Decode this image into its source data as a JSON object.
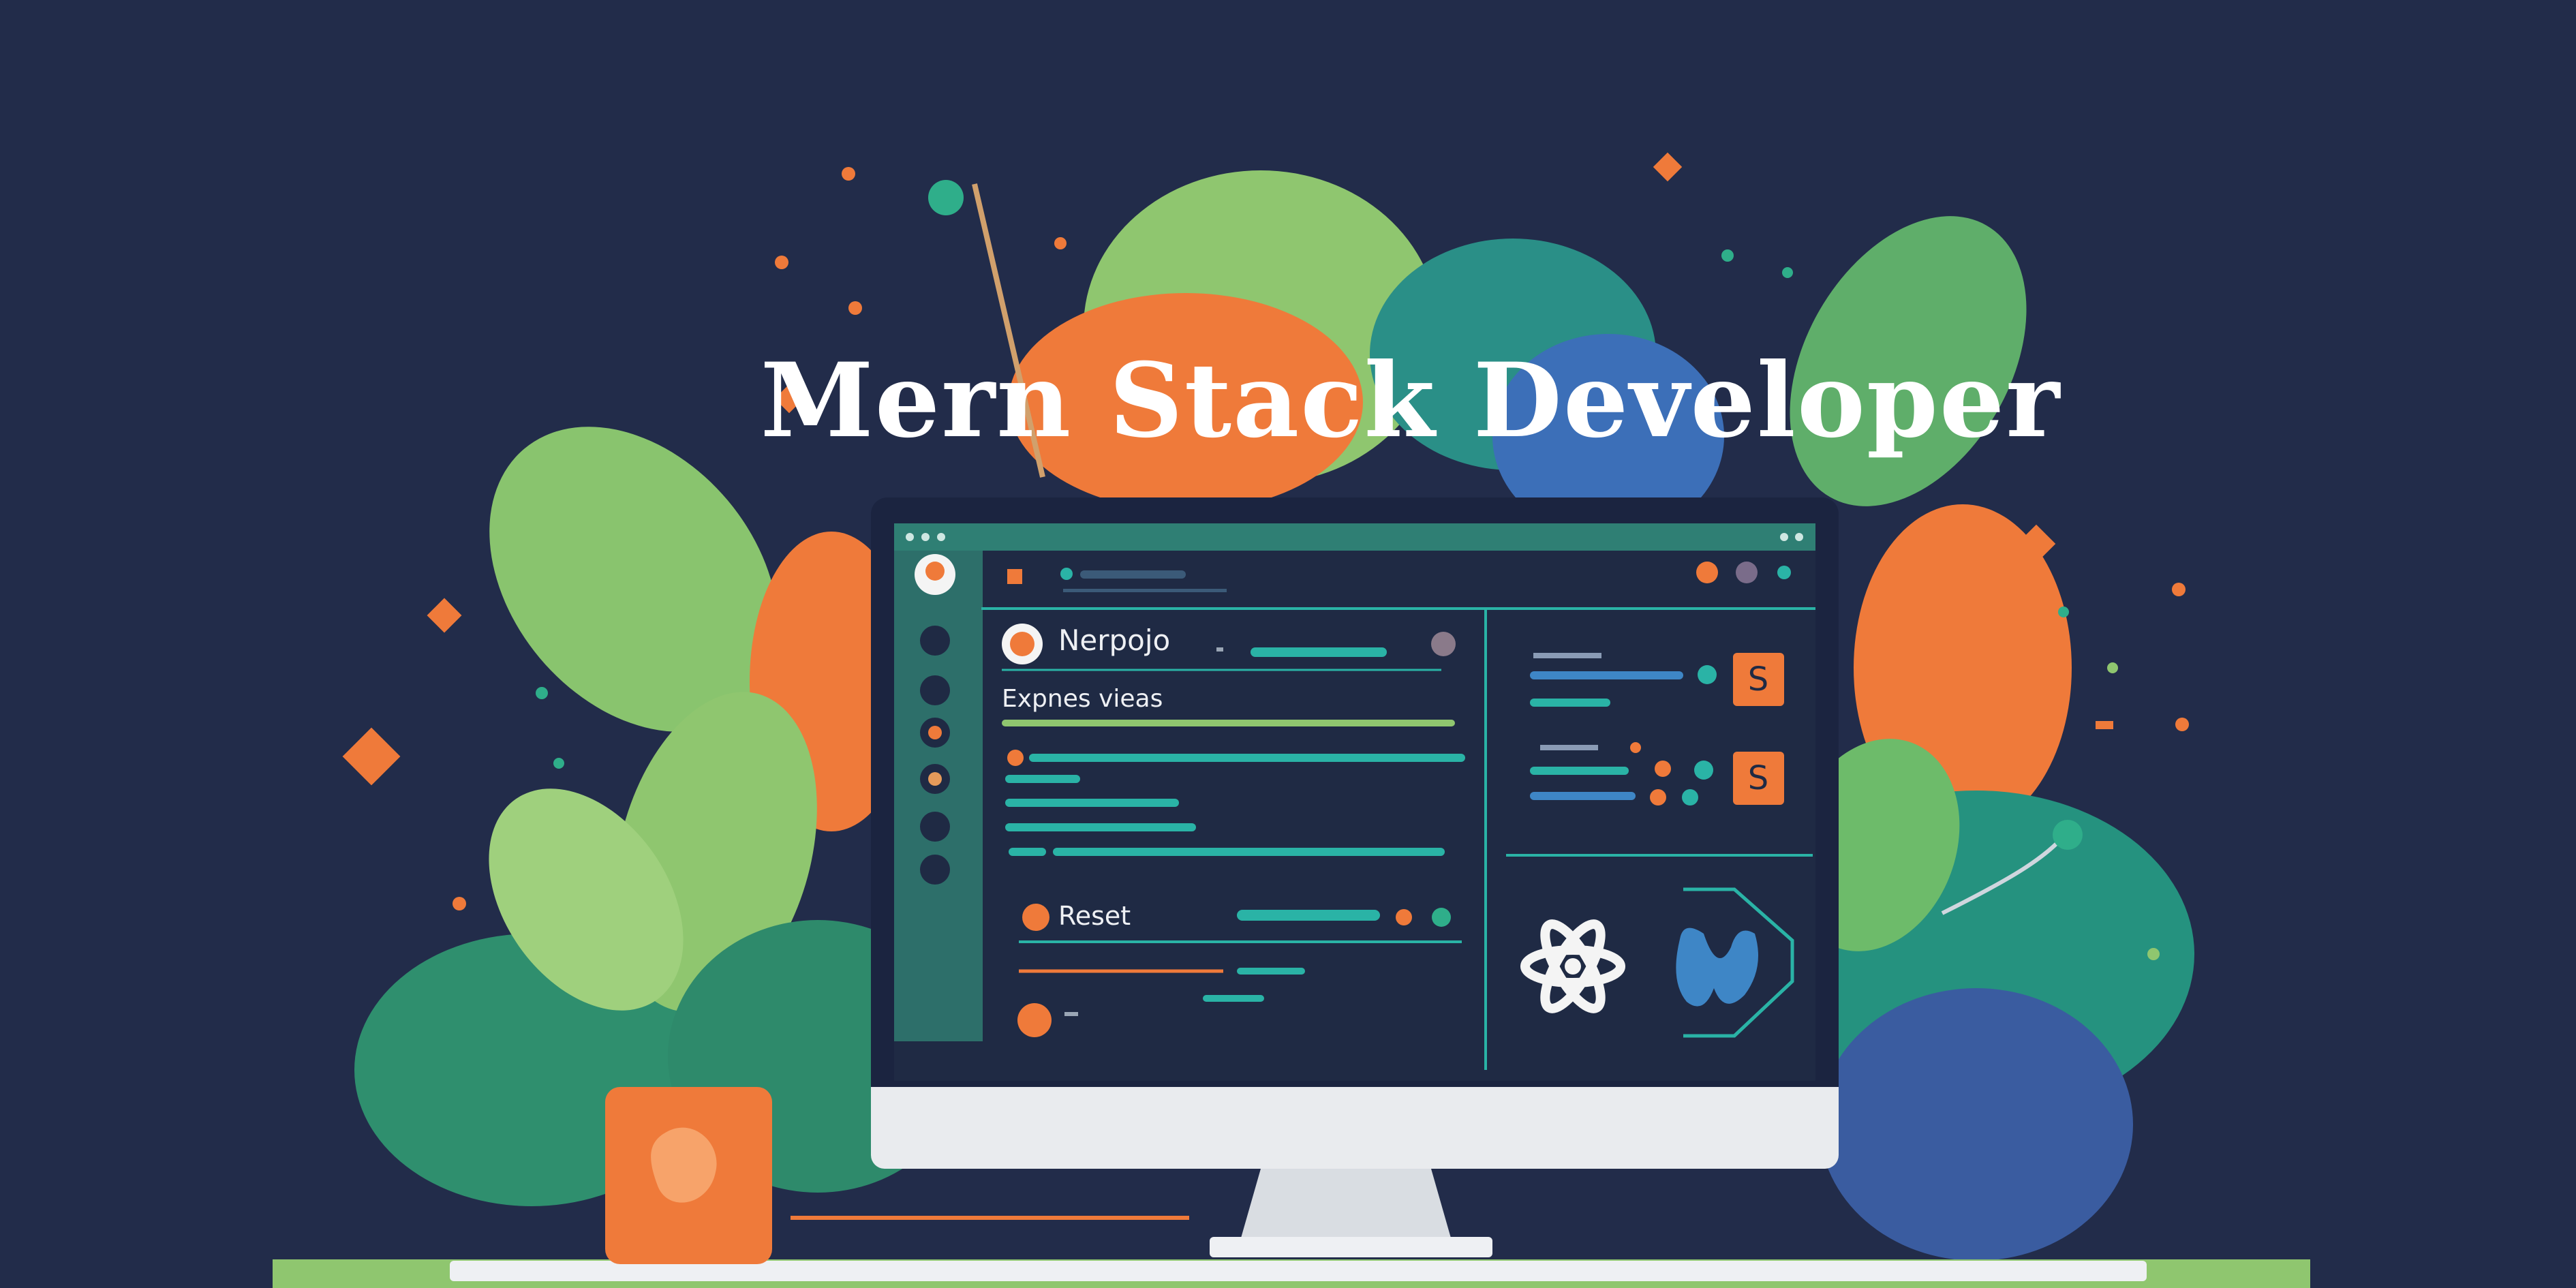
{
  "title": "Mern Stack Developer",
  "monitor": {
    "app_name": "Nerpojo",
    "section_label": "Expnes vieas",
    "action_label": "Reset",
    "card_badges": [
      "S",
      "S"
    ]
  },
  "colors": {
    "background": "#222c4a",
    "leaf_green_light": "#8fc66f",
    "leaf_green_dark": "#2f8f6e",
    "teal": "#2ab3a6",
    "orange": "#ef7a3a",
    "screen_bg": "#1f2a44",
    "screen_accent": "#2f7f74",
    "monitor_stand": "#e9ebee"
  },
  "icons": [
    "react-logo-icon",
    "code-logo-icon",
    "avatar-icon"
  ]
}
